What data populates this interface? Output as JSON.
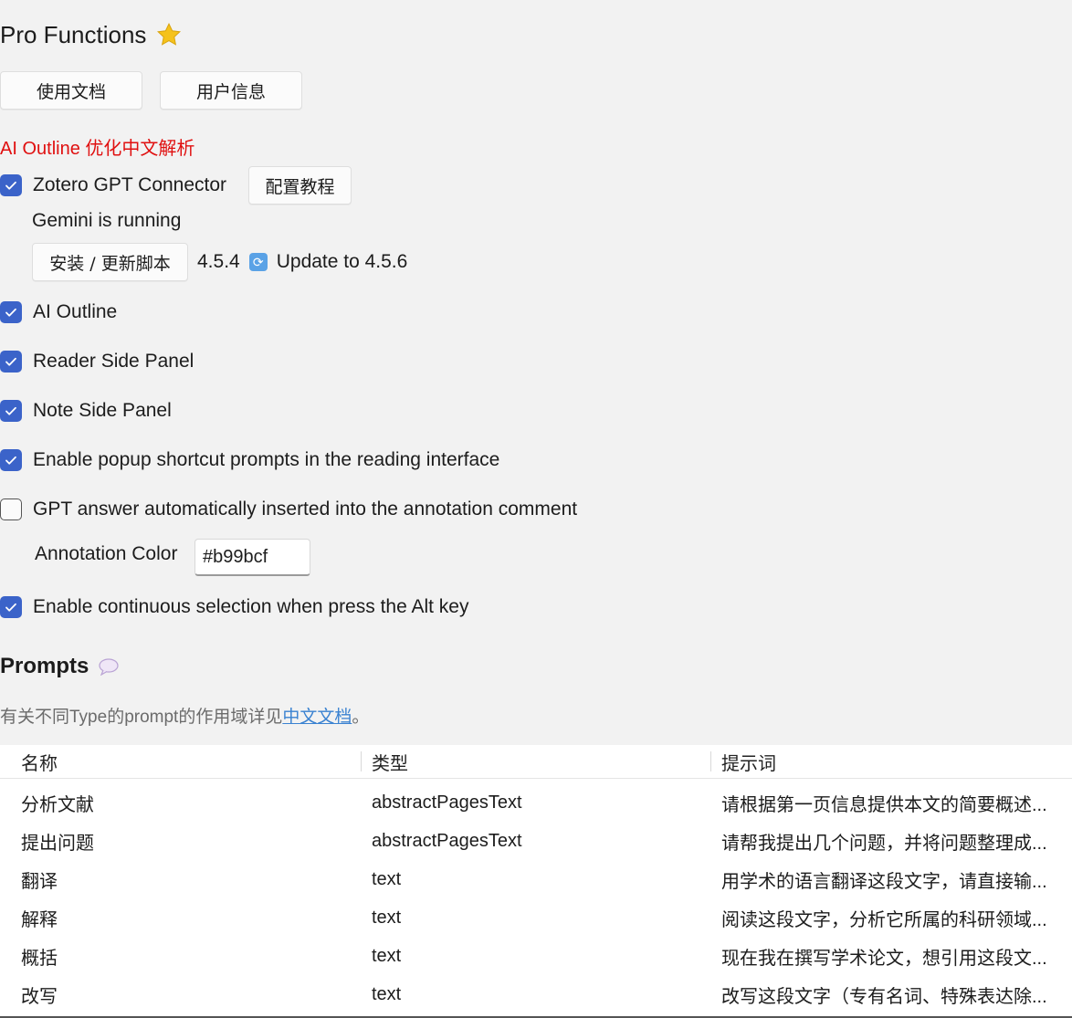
{
  "header": {
    "title": "Pro Functions",
    "icon": "star-icon"
  },
  "buttons": {
    "docs": "使用文档",
    "user_info": "用户信息"
  },
  "notice": "AI Outline 优化中文解析",
  "options": {
    "gpt_connector": {
      "label": "Zotero GPT Connector",
      "checked": true,
      "tutorial_button": "配置教程"
    },
    "status": "Gemini is running",
    "install_button": "安装 / 更新脚本",
    "version": "4.5.4",
    "update_text": "Update to 4.5.6",
    "ai_outline": {
      "label": "AI Outline",
      "checked": true
    },
    "reader_panel": {
      "label": "Reader Side Panel",
      "checked": true
    },
    "note_panel": {
      "label": "Note Side Panel",
      "checked": true
    },
    "popup_prompts": {
      "label": "Enable popup shortcut prompts in the reading interface",
      "checked": true
    },
    "auto_insert": {
      "label": "GPT answer automatically inserted into the annotation comment",
      "checked": false
    },
    "annotation_color": {
      "label": "Annotation Color",
      "value": "#b99bcf"
    },
    "alt_select": {
      "label": "Enable continuous selection when press the Alt key",
      "checked": true
    }
  },
  "prompts": {
    "title": "Prompts",
    "icon": "speech-bubble-icon",
    "help_prefix": "有关不同Type的prompt的作用域详见",
    "help_link": "中文文档",
    "help_suffix": "。",
    "columns": [
      "名称",
      "类型",
      "提示词"
    ],
    "rows": [
      [
        "分析文献",
        "abstractPagesText",
        "请根据第一页信息提供本文的简要概述..."
      ],
      [
        "提出问题",
        "abstractPagesText",
        "请帮我提出几个问题，并将问题整理成..."
      ],
      [
        "翻译",
        "text",
        "用学术的语言翻译这段文字，请直接输..."
      ],
      [
        "解释",
        "text",
        "阅读这段文字，分析它所属的科研领域..."
      ],
      [
        "概括",
        "text",
        "现在我在撰写学术论文，想引用这段文..."
      ],
      [
        "改写",
        "text",
        "改写这段文字（专有名词、特殊表达除..."
      ]
    ]
  },
  "colors": {
    "accent": "#3b63c9",
    "notice": "#e01010",
    "link": "#3a82d1"
  }
}
